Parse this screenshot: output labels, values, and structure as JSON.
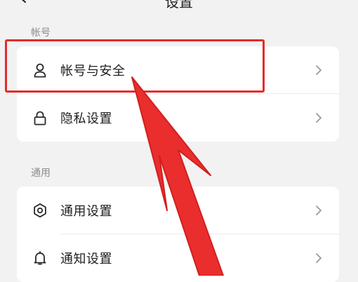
{
  "header": {
    "title": "设置"
  },
  "sections": [
    {
      "label": "帐号",
      "items": [
        {
          "label": "帐号与安全",
          "icon": "person-icon"
        },
        {
          "label": "隐私设置",
          "icon": "lock-icon"
        }
      ]
    },
    {
      "label": "通用",
      "items": [
        {
          "label": "通用设置",
          "icon": "gear-icon"
        },
        {
          "label": "通知设置",
          "icon": "bell-icon"
        }
      ]
    }
  ],
  "colors": {
    "background": "#f2f2f2",
    "card": "#ffffff",
    "annotation_red": "#e52b2b",
    "muted_text": "#8c8c8c"
  }
}
